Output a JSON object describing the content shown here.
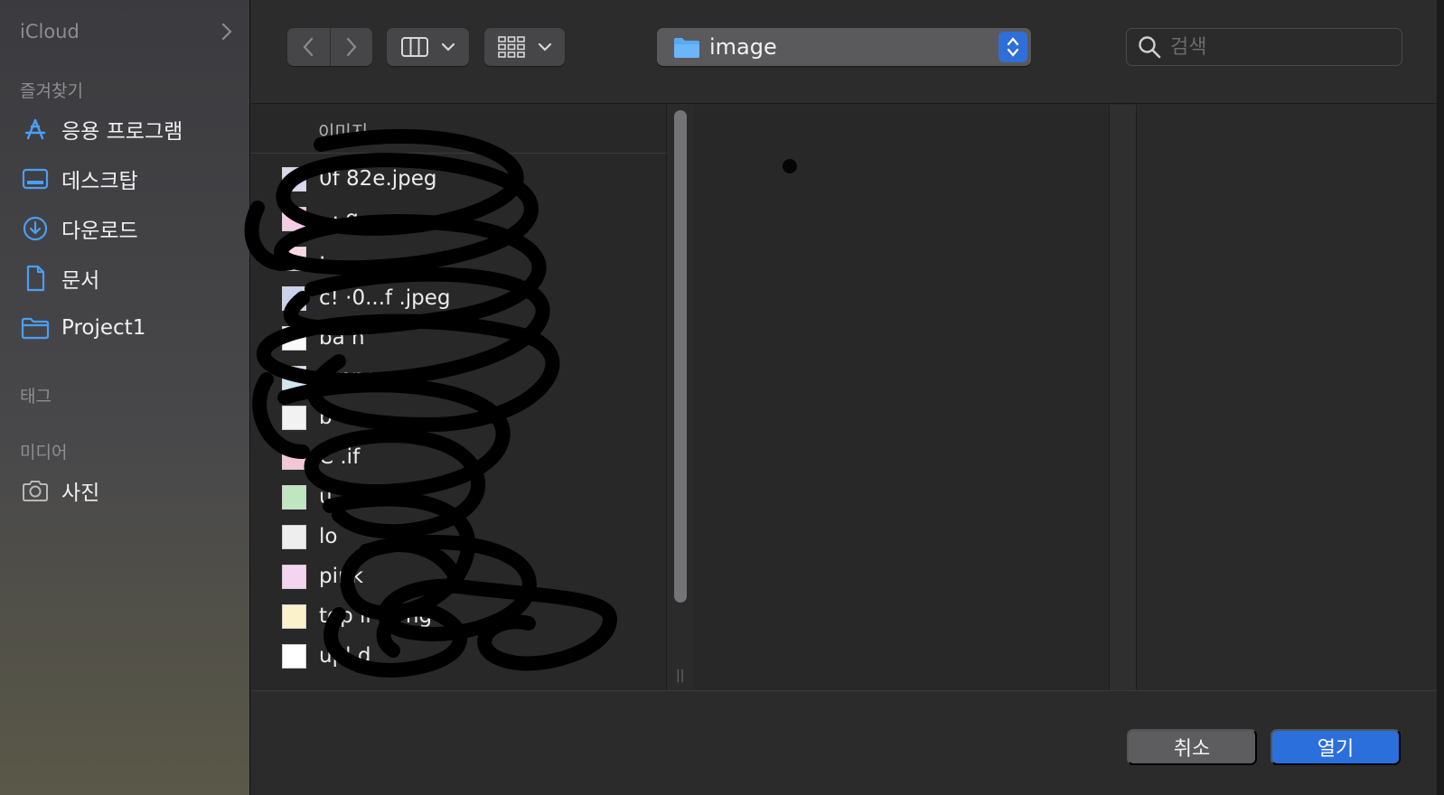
{
  "sidebar": {
    "icloud_label": "iCloud",
    "favorites_label": "즐겨찾기",
    "favorites": [
      {
        "label": "응용 프로그램",
        "icon": "applications-icon"
      },
      {
        "label": "데스크탑",
        "icon": "desktop-icon"
      },
      {
        "label": "다운로드",
        "icon": "downloads-icon"
      },
      {
        "label": "문서",
        "icon": "document-icon"
      },
      {
        "label": "Project1",
        "icon": "folder-icon"
      }
    ],
    "tags_label": "태그",
    "media_label": "미디어",
    "media": [
      {
        "label": "사진",
        "icon": "camera-icon"
      }
    ]
  },
  "toolbar": {
    "location": "image",
    "search_placeholder": "검색"
  },
  "browser": {
    "column_header": "이미지",
    "files": [
      {
        "name": "0f                82e.jpeg"
      },
      {
        "name": "  ·  ·        g"
      },
      {
        "name": "  ·"
      },
      {
        "name": "c!        ·0...f       .jpeg"
      },
      {
        "name": "ba     n"
      },
      {
        "name": "   e.png"
      },
      {
        "name": "b   "
      },
      {
        "name": "C        .if"
      },
      {
        "name": "        u"
      },
      {
        "name": "lo     "
      },
      {
        "name": "pink"
      },
      {
        "name": "top ir       lo          ng"
      },
      {
        "name": "upl   d"
      }
    ]
  },
  "footer": {
    "cancel_label": "취소",
    "open_label": "열기"
  },
  "colors": {
    "accent": "#2b6fdc",
    "folder": "#5aa9f0"
  }
}
